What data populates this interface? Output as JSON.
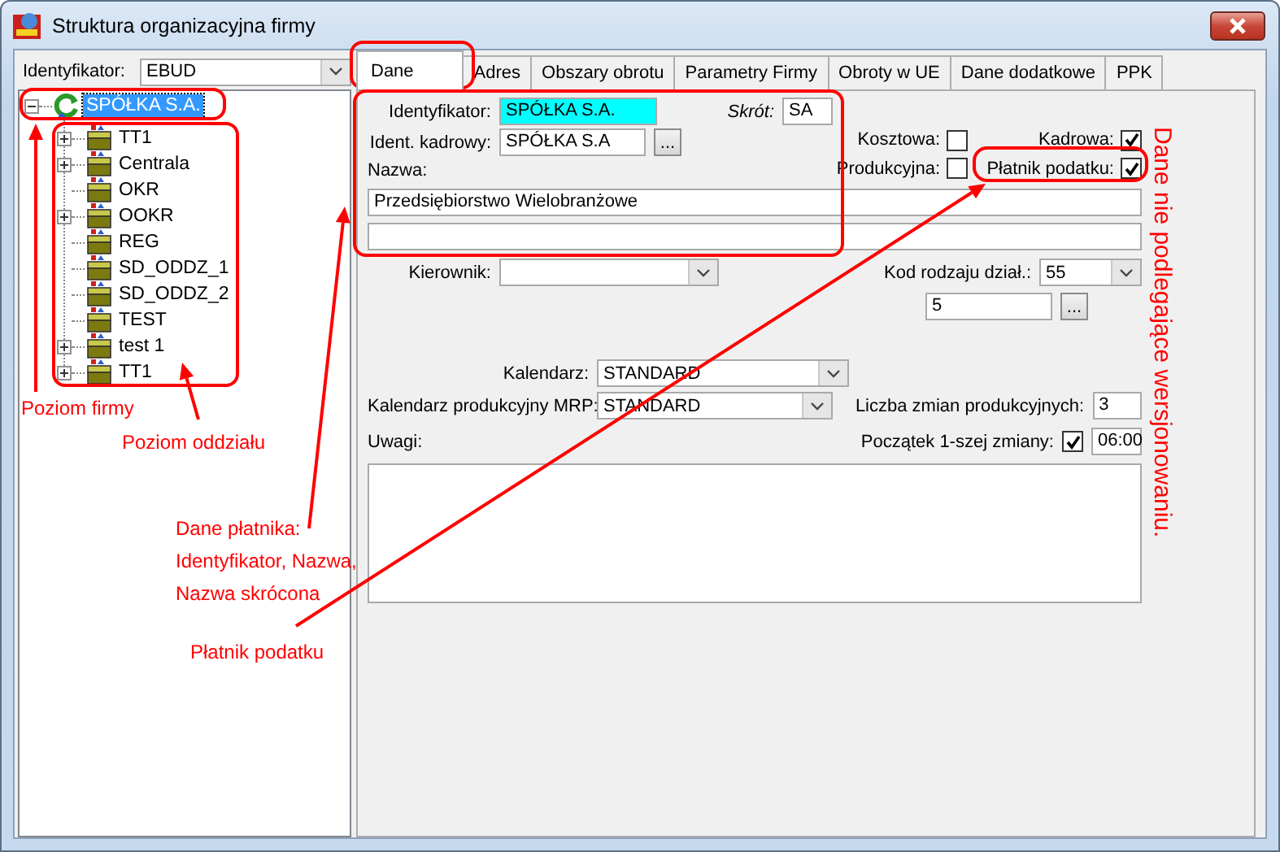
{
  "window": {
    "title": "Struktura organizacyjna firmy"
  },
  "identifier": {
    "label": "Identyfikator:",
    "value": "EBUD"
  },
  "tree": [
    {
      "label": "SPÓŁKA S.A.",
      "selected": true,
      "expandable": true,
      "expanded": true,
      "children": [
        {
          "label": "TT1",
          "selected": false,
          "expandable": true
        },
        {
          "label": "Centrala",
          "selected": false,
          "expandable": true
        },
        {
          "label": "OKR",
          "selected": false,
          "expandable": false
        },
        {
          "label": "OOKR",
          "selected": false,
          "expandable": true
        },
        {
          "label": "REG",
          "selected": false,
          "expandable": false
        },
        {
          "label": "SD_ODDZ_1",
          "selected": false,
          "expandable": false
        },
        {
          "label": "SD_ODDZ_2",
          "selected": false,
          "expandable": false
        },
        {
          "label": "TEST",
          "selected": false,
          "expandable": false
        },
        {
          "label": "test 1",
          "selected": false,
          "expandable": true
        },
        {
          "label": "TT1",
          "selected": false,
          "expandable": true
        }
      ]
    }
  ],
  "tabs": [
    {
      "label": "Dane",
      "selected": true
    },
    {
      "label": "Adres",
      "selected": false
    },
    {
      "label": "Obszary obrotu",
      "selected": false
    },
    {
      "label": "Parametry Firmy",
      "selected": false
    },
    {
      "label": "Obroty w UE",
      "selected": false
    },
    {
      "label": "Dane dodatkowe",
      "selected": false
    },
    {
      "label": "PPK",
      "selected": false
    }
  ],
  "form": {
    "identifier": {
      "label": "Identyfikator:",
      "value": "SPÓŁKA S.A."
    },
    "short": {
      "label": "Skrót:",
      "value": "SA"
    },
    "hr_id": {
      "label": "Ident. kadrowy:",
      "value": "SPÓŁKA S.A",
      "button": "..."
    },
    "checkboxes": [
      {
        "label": "Kosztowa:",
        "checked": false
      },
      {
        "label": "Kadrowa:",
        "checked": true
      },
      {
        "label": "Produkcyjna:",
        "checked": false
      },
      {
        "label": "Płatnik podatku:",
        "checked": true
      }
    ],
    "name": {
      "label": "Nazwa:",
      "value": "Przedsiębiorstwo Wielobranżowe"
    },
    "manager": {
      "label": "Kierownik:"
    },
    "activity_code": {
      "label": "Kod rodzaju dział.:",
      "value": "55"
    },
    "activity_sub": {
      "value": "5",
      "button": "..."
    },
    "calendar": {
      "label": "Kalendarz:",
      "value": "STANDARD"
    },
    "mrp_calendar": {
      "label": "Kalendarz produkcyjny MRP:",
      "value": "STANDARD"
    },
    "shifts": {
      "label": "Liczba zmian produkcyjnych:",
      "value": "3"
    },
    "shift_start": {
      "label": "Początek 1-szej zmiany:",
      "checked": true,
      "value": "06:00"
    },
    "notes": {
      "label": "Uwagi:"
    }
  },
  "annotations": [
    {
      "text": "Poziom firmy"
    },
    {
      "text": "Poziom oddziału"
    },
    {
      "text": "Dane płatnika:\nIdentyfikator, Nazwa,\nNazwa skrócona"
    },
    {
      "text": "Płatnik podatku"
    }
  ],
  "side_note": "Dane nie podlegające wersjonowaniu."
}
